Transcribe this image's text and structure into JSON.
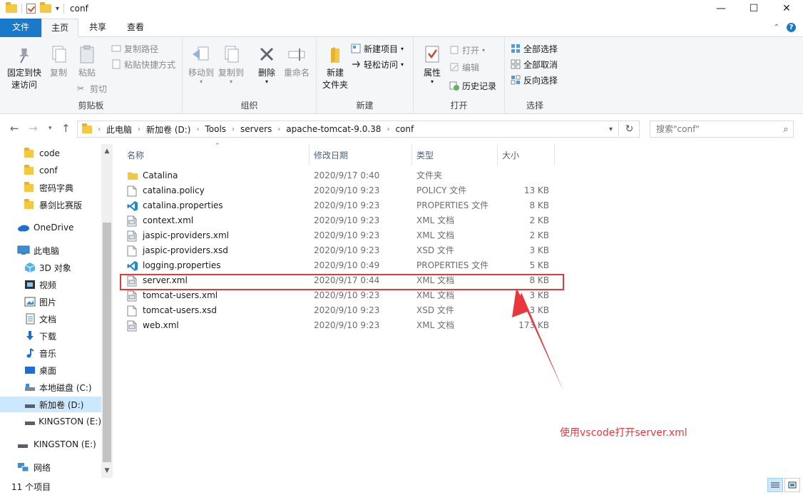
{
  "window": {
    "title": "conf"
  },
  "ribbon_tabs": {
    "file": "文件",
    "home": "主页",
    "share": "共享",
    "view": "查看"
  },
  "ribbon": {
    "clipboard": {
      "label": "剪贴板",
      "pin": "固定到快\n速访问",
      "copy": "复制",
      "paste": "粘贴",
      "copy_path": "复制路径",
      "paste_shortcut": "粘贴快捷方式",
      "cut": "剪切"
    },
    "organize": {
      "label": "组织",
      "move_to": "移动到",
      "copy_to": "复制到",
      "delete": "删除",
      "rename": "重命名"
    },
    "new": {
      "label": "新建",
      "new_folder": "新建\n文件夹",
      "new_item": "新建项目",
      "easy_access": "轻松访问"
    },
    "open": {
      "label": "打开",
      "properties": "属性",
      "open": "打开",
      "edit": "编辑",
      "history": "历史记录"
    },
    "select": {
      "label": "选择",
      "select_all": "全部选择",
      "select_none": "全部取消",
      "invert": "反向选择"
    }
  },
  "address": {
    "crumbs": [
      "此电脑",
      "新加卷 (D:)",
      "Tools",
      "servers",
      "apache-tomcat-9.0.38",
      "conf"
    ]
  },
  "search": {
    "placeholder": "搜索\"conf\""
  },
  "nav_pane": [
    {
      "label": "code",
      "icon": "folder-icon"
    },
    {
      "label": "conf",
      "icon": "folder-icon"
    },
    {
      "label": "密码字典",
      "icon": "folder-icon"
    },
    {
      "label": "暴剑比赛版",
      "icon": "folder-icon"
    },
    {
      "label": "OneDrive",
      "icon": "cloud-icon"
    },
    {
      "label": "此电脑",
      "icon": "computer-icon"
    },
    {
      "label": "3D 对象",
      "icon": "3d-objects-icon"
    },
    {
      "label": "视频",
      "icon": "video-icon"
    },
    {
      "label": "图片",
      "icon": "pictures-icon"
    },
    {
      "label": "文档",
      "icon": "documents-icon"
    },
    {
      "label": "下载",
      "icon": "download-icon"
    },
    {
      "label": "音乐",
      "icon": "music-icon"
    },
    {
      "label": "桌面",
      "icon": "desktop-icon"
    },
    {
      "label": "本地磁盘 (C:)",
      "icon": "drive-icon"
    },
    {
      "label": "新加卷 (D:)",
      "icon": "drive-icon"
    },
    {
      "label": "KINGSTON (E:)",
      "icon": "usb-drive-icon"
    },
    {
      "label": "KINGSTON (E:)",
      "icon": "usb-drive-icon"
    },
    {
      "label": "网络",
      "icon": "network-icon"
    }
  ],
  "columns": {
    "name": "名称",
    "date": "修改日期",
    "type": "类型",
    "size": "大小"
  },
  "files": [
    {
      "name": "Catalina",
      "date": "2020/9/17 0:40",
      "type": "文件夹",
      "size": "",
      "icon": "folder-icon"
    },
    {
      "name": "catalina.policy",
      "date": "2020/9/10 9:23",
      "type": "POLICY 文件",
      "size": "13 KB",
      "icon": "file-icon"
    },
    {
      "name": "catalina.properties",
      "date": "2020/9/10 9:23",
      "type": "PROPERTIES 文件",
      "size": "8 KB",
      "icon": "vscode-icon"
    },
    {
      "name": "context.xml",
      "date": "2020/9/10 9:23",
      "type": "XML 文档",
      "size": "2 KB",
      "icon": "xml-icon"
    },
    {
      "name": "jaspic-providers.xml",
      "date": "2020/9/10 9:23",
      "type": "XML 文档",
      "size": "2 KB",
      "icon": "xml-icon"
    },
    {
      "name": "jaspic-providers.xsd",
      "date": "2020/9/10 9:23",
      "type": "XSD 文件",
      "size": "3 KB",
      "icon": "file-icon"
    },
    {
      "name": "logging.properties",
      "date": "2020/9/10 0:49",
      "type": "PROPERTIES 文件",
      "size": "5 KB",
      "icon": "vscode-icon"
    },
    {
      "name": "server.xml",
      "date": "2020/9/17 0:44",
      "type": "XML 文档",
      "size": "8 KB",
      "icon": "xml-icon"
    },
    {
      "name": "tomcat-users.xml",
      "date": "2020/9/10 9:23",
      "type": "XML 文档",
      "size": "3 KB",
      "icon": "xml-icon"
    },
    {
      "name": "tomcat-users.xsd",
      "date": "2020/9/10 9:23",
      "type": "XSD 文件",
      "size": "3 KB",
      "icon": "file-icon"
    },
    {
      "name": "web.xml",
      "date": "2020/9/10 9:23",
      "type": "XML 文档",
      "size": "173 KB",
      "icon": "xml-icon"
    }
  ],
  "status": {
    "count": "11 个项目"
  },
  "annotation": {
    "text": "使用vscode打开server.xml",
    "color": "#e8383d"
  },
  "colors": {
    "accent": "#1979ca",
    "selection": "#cce8ff",
    "folder": "#f5c843"
  }
}
